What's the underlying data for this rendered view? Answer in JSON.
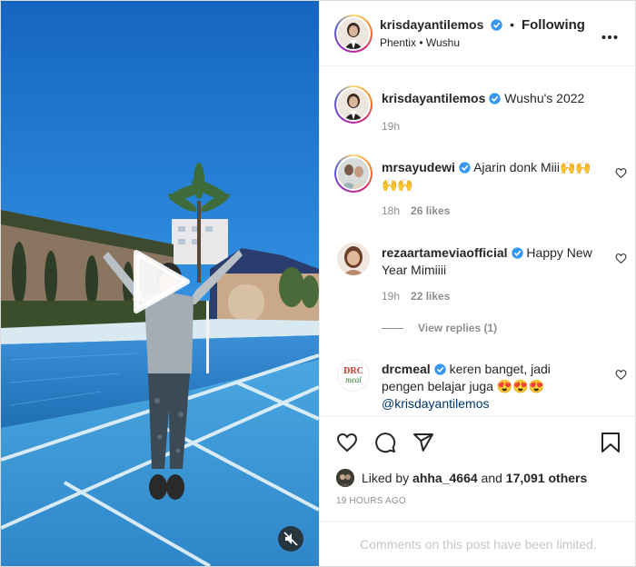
{
  "post": {
    "author": "krisdayantilemos",
    "follow_status": "Following",
    "dot": "•",
    "location": "Phentix • Wushu",
    "more_icon": "more-horizontal-icon"
  },
  "caption": {
    "username": "krisdayantilemos",
    "text": "Wushu's 2022",
    "time": "19h"
  },
  "comments": [
    {
      "username": "mrsayudewi",
      "text": "Ajarin donk Miii🙌🙌🙌🙌",
      "time": "18h",
      "likes": "26 likes"
    },
    {
      "username": "rezaartameviaofficial",
      "text": "Happy New Year Mimiiii",
      "time": "19h",
      "likes": "22 likes",
      "view_replies": "View replies (1)"
    },
    {
      "username": "drcmeal",
      "text": "keren banget, jadi pengen belajar juga 😍😍😍",
      "mention": "@krisdayantilemos"
    }
  ],
  "drc_logo": {
    "line1": "DRC",
    "line2": "meal"
  },
  "engagement": {
    "liked_by_prefix": "Liked by",
    "liked_by_user": "ahha_4664",
    "and": "and",
    "others": "17,091 others",
    "posted": "19 HOURS AGO"
  },
  "limited_notice": "Comments on this post have been limited.",
  "colors": {
    "verified": "#3897f0",
    "accent_link": "#00376b",
    "muted": "#8e8e8e"
  }
}
